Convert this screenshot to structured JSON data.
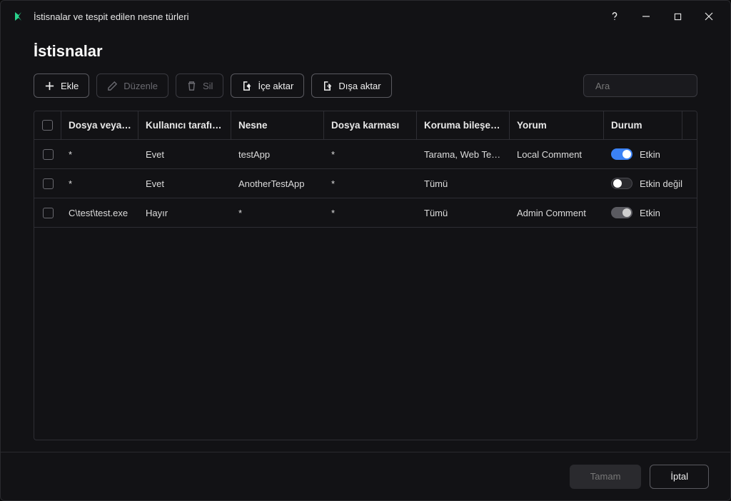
{
  "window": {
    "title": "İstisnalar ve tespit edilen nesne türleri"
  },
  "page": {
    "heading": "İstisnalar"
  },
  "toolbar": {
    "add": "Ekle",
    "edit": "Düzenle",
    "delete": "Sil",
    "import": "İçe aktar",
    "export": "Dışa aktar"
  },
  "search": {
    "placeholder": "Ara"
  },
  "table": {
    "headers": {
      "file": "Dosya veya…",
      "user": "Kullanıcı tarafı…",
      "object": "Nesne",
      "hash": "Dosya karması",
      "protection": "Koruma bileşe…",
      "comment": "Yorum",
      "status": "Durum"
    },
    "rows": [
      {
        "file": "*",
        "user": "Evet",
        "object": "testApp",
        "hash": "*",
        "protection": "Tarama, Web Te…",
        "comment": "Local Comment",
        "status_label": "Etkin",
        "toggle": "on-blue"
      },
      {
        "file": "*",
        "user": "Evet",
        "object": "AnotherTestApp",
        "hash": "*",
        "protection": "Tümü",
        "comment": "",
        "status_label": "Etkin değil",
        "toggle": "off"
      },
      {
        "file": "C\\test\\test.exe",
        "user": "Hayır",
        "object": "*",
        "hash": "*",
        "protection": "Tümü",
        "comment": "Admin Comment",
        "status_label": "Etkin",
        "toggle": "on-grey"
      }
    ]
  },
  "footer": {
    "ok": "Tamam",
    "cancel": "İptal"
  }
}
